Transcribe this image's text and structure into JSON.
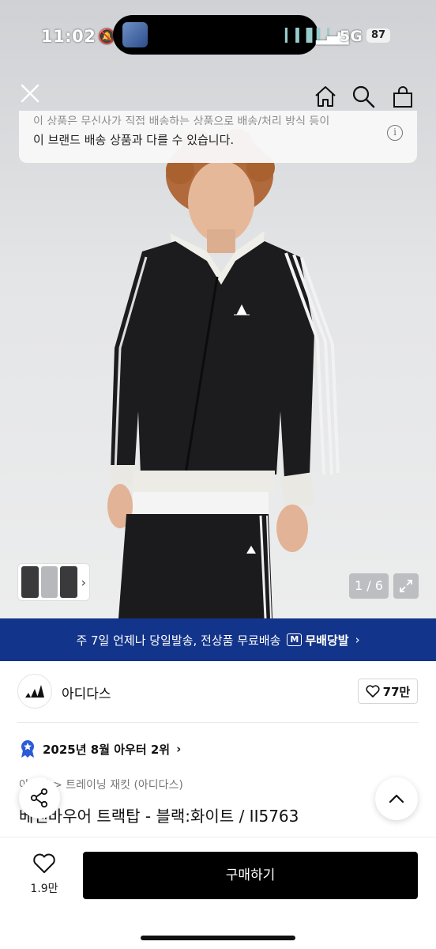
{
  "status_bar": {
    "time": "11:02",
    "network": "5G",
    "battery": "87"
  },
  "nav": {
    "close_icon": "close-icon",
    "home_icon": "home-icon",
    "search_icon": "search-icon",
    "cart_icon": "shopping-bag-icon"
  },
  "notice": {
    "line1": "이 상품은 무신사가 직접 배송하는 상품으로 배송/처리 방식 등이",
    "line2": "이 브랜드 배송 상품과 다를 수 있습니다.",
    "info_symbol": "i"
  },
  "gallery": {
    "counter": "1 / 6",
    "thumbs_chevron": "›"
  },
  "delivery_banner": {
    "text": "주 7일 언제나 당일발송, 전상품 무료배송",
    "badge_mark": "M",
    "badge_text": "무배당발",
    "chevron": "›"
  },
  "brand": {
    "name": "아디다스",
    "likes": "77만"
  },
  "ranking": {
    "text": "2025년 8월 아우터 2위",
    "chevron": "›"
  },
  "breadcrumb": {
    "text": "아우터 > 트레이닝 재킷 (아디다스)"
  },
  "product": {
    "title": "베켄바우어 트랙탑 - 블랙:화이트 / II5763"
  },
  "bottom": {
    "wish_count": "1.9만",
    "buy_label": "구매하기"
  },
  "colors": {
    "banner": "#12348a",
    "buy_button": "#000000",
    "rank_badge": "#2b5bd7"
  }
}
